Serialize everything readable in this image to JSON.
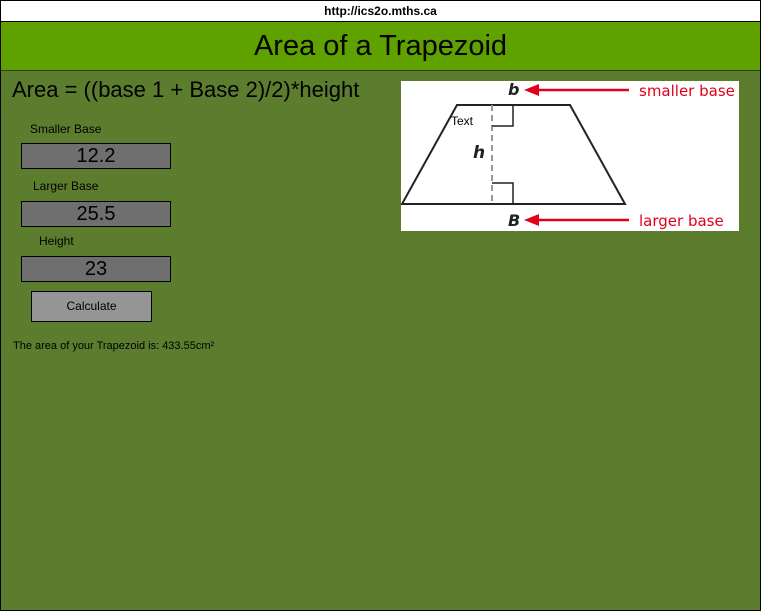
{
  "browser": {
    "url": "http://ics2o.mths.ca"
  },
  "header": {
    "title": "Area of a Trapezoid"
  },
  "formula": {
    "text": "Area = ((base 1 + Base 2)/2)*height"
  },
  "form": {
    "smaller_base": {
      "label": "Smaller Base",
      "value": "12.2"
    },
    "larger_base": {
      "label": "Larger Base",
      "value": "25.5"
    },
    "height": {
      "label": "Height",
      "value": "23"
    },
    "calculate_label": "Calculate"
  },
  "result": {
    "text": "The area of your Trapezoid is: 433.55cm²"
  },
  "diagram": {
    "overlay_text": "Text",
    "small_base_letter": "b",
    "large_base_letter": "B",
    "height_letter": "h",
    "smaller_base_caption": "smaller base",
    "larger_base_caption": "larger base"
  },
  "colors": {
    "page_background": "#5d7d2e",
    "header_background": "#5fa200",
    "input_background": "#6f6f6f",
    "button_background": "#959595",
    "diagram_arrow": "#e0001b"
  }
}
